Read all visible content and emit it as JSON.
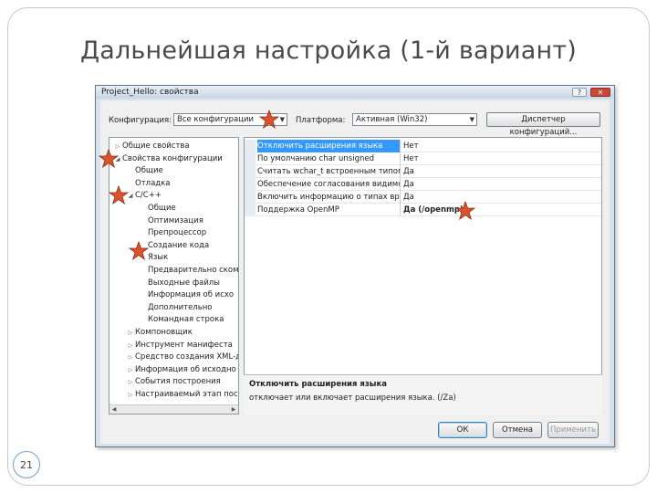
{
  "slide": {
    "title": "Дальнейшая настройка (1-й вариант)",
    "page_number": "21"
  },
  "dialog": {
    "title": "Project_Hello: свойства",
    "help_button": "?",
    "close_button": "✕",
    "configuration_label": "Конфигурация:",
    "configuration_value": "Все конфигурации",
    "platform_label": "Платформа:",
    "platform_value": "Активная (Win32)",
    "config_manager_button": "Диспетчер конфигураций...",
    "tree": [
      {
        "label": "Общие свойства",
        "level": 0,
        "expander": "▷"
      },
      {
        "label": "Свойства конфигурации",
        "level": 0,
        "expander": "◢"
      },
      {
        "label": "Общие",
        "level": 1,
        "expander": ""
      },
      {
        "label": "Отладка",
        "level": 1,
        "expander": ""
      },
      {
        "label": "C/C++",
        "level": 1,
        "expander": "◢"
      },
      {
        "label": "Общие",
        "level": 2,
        "expander": ""
      },
      {
        "label": "Оптимизация",
        "level": 2,
        "expander": ""
      },
      {
        "label": "Препроцессор",
        "level": 2,
        "expander": ""
      },
      {
        "label": "Создание кода",
        "level": 2,
        "expander": ""
      },
      {
        "label": "Язык",
        "level": 2,
        "expander": ""
      },
      {
        "label": "Предварительно ском",
        "level": 2,
        "expander": ""
      },
      {
        "label": "Выходные файлы",
        "level": 2,
        "expander": ""
      },
      {
        "label": "Информация об исхо",
        "level": 2,
        "expander": ""
      },
      {
        "label": "Дополнительно",
        "level": 2,
        "expander": ""
      },
      {
        "label": "Командная строка",
        "level": 2,
        "expander": ""
      },
      {
        "label": "Компоновщик",
        "level": 1,
        "expander": "▷"
      },
      {
        "label": "Инструмент манифеста",
        "level": 1,
        "expander": "▷"
      },
      {
        "label": "Средство создания XML-д",
        "level": 1,
        "expander": "▷"
      },
      {
        "label": "Информация об исходно",
        "level": 1,
        "expander": "▷"
      },
      {
        "label": "События построения",
        "level": 1,
        "expander": "▷"
      },
      {
        "label": "Настраиваемый этап пос",
        "level": 1,
        "expander": "▷"
      }
    ],
    "properties": [
      {
        "name": "Отключить расширения языка",
        "value": "Нет",
        "bold": false
      },
      {
        "name": "По умолчанию char unsigned",
        "value": "Нет",
        "bold": false
      },
      {
        "name": "Считать wchar_t встроенным типом",
        "value": "Да",
        "bold": false
      },
      {
        "name": "Обеспечение согласования видимос",
        "value": "Да",
        "bold": false
      },
      {
        "name": "Включить информацию о типах врем",
        "value": "Да",
        "bold": false
      },
      {
        "name": "Поддержка OpenMP",
        "value": "Да (/openmp)",
        "bold": true
      }
    ],
    "description_title": "Отключить расширения языка",
    "description_text": "отключает или включает расширения языка. (/Za)",
    "ok_button": "ОК",
    "cancel_button": "Отмена",
    "apply_button": "Применить"
  },
  "annotations": {
    "star_color": "#d9532c",
    "star_count": 6
  }
}
